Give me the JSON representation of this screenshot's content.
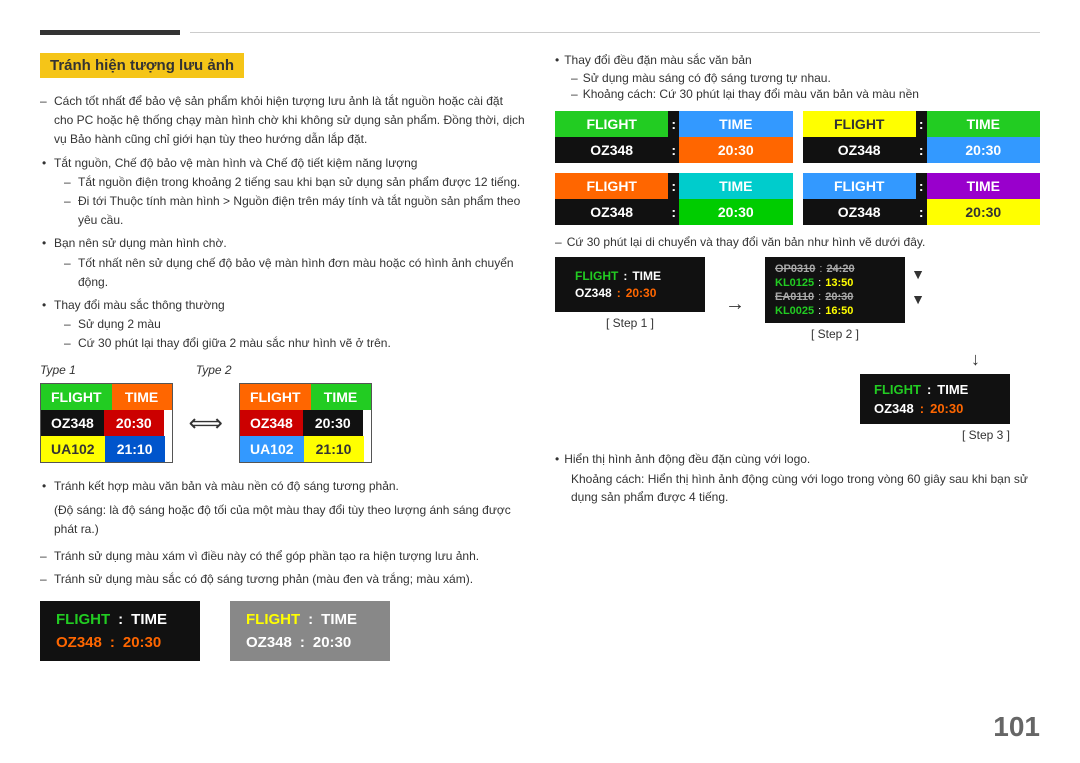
{
  "page": {
    "number": "101"
  },
  "header": {
    "section_title": "Tránh hiện tượng lưu ảnh"
  },
  "left": {
    "intro": "Cách tốt nhất để bảo vệ sản phẩm khỏi hiện tượng lưu ảnh là tắt nguồn hoặc cài đặt cho PC hoặc hệ thống chạy màn hình chờ khi không sử dụng sản phẩm. Đồng thời, dịch vụ Bảo hành cũng chỉ giới hạn tùy theo hướng dẫn lắp đặt.",
    "bullets": [
      {
        "text": "Tắt nguồn, Chế độ bảo vệ màn hình và Chế độ tiết kiệm năng lượng",
        "subs": [
          "Tắt nguồn điện trong khoảng 2 tiếng sau khi bạn sử dụng sản phẩm được 12 tiếng.",
          "Đi tới Thuộc tính màn hình > Nguồn điện trên máy tính và tắt nguồn sản phẩm theo yêu cầu."
        ]
      },
      {
        "text": "Bạn nên sử dụng màn hình chờ.",
        "subs": [
          "Tốt nhất nên sử dụng chế độ bảo vệ màn hình đơn màu hoặc có hình ảnh chuyển động."
        ]
      },
      {
        "text": "Thay đổi màu sắc thông thường",
        "subs": [
          "Sử dụng 2 màu",
          "Cứ 30 phút lại thay đổi giữa 2 màu sắc như hình vẽ ở trên."
        ]
      }
    ],
    "type1_label": "Type 1",
    "type2_label": "Type 2",
    "board_t1": {
      "row1": [
        "FLIGHT",
        "TIME"
      ],
      "row2": [
        "OZ348",
        "20:30"
      ],
      "row3": [
        "UA102",
        "21:10"
      ]
    },
    "board_t2": {
      "row1": [
        "FLIGHT",
        "TIME"
      ],
      "row2": [
        "OZ348",
        "20:30"
      ],
      "row3": [
        "UA102",
        "21:10"
      ]
    },
    "bullet2_items": [
      "Tránh kết hợp màu văn bản và màu nền có độ sáng tương phản.",
      "(Độ sáng: là độ sáng hoặc độ tối của một màu thay đổi tùy theo lượng ánh sáng được phát ra.)"
    ],
    "dash_items": [
      "Tránh sử dụng màu xám vì điều này có thể góp phần tạo ra hiện tượng lưu ảnh.",
      "Tránh sử dụng màu sắc có độ sáng tương phản (màu đen và trắng; màu xám)."
    ],
    "bottom_board_black": {
      "title": [
        "FLIGHT",
        ":",
        "TIME"
      ],
      "value": [
        "OZ348",
        ":",
        "20:30"
      ]
    },
    "bottom_board_gray": {
      "title": [
        "FLIGHT",
        ":",
        "TIME"
      ],
      "value": [
        "OZ348",
        ":",
        "20:30"
      ]
    }
  },
  "right": {
    "bullet1": "Thay đổi đều đặn màu sắc văn bản",
    "sub1": "Sử dụng màu sáng có độ sáng tương tự nhau.",
    "sub2": "Khoảng cách: Cứ 30 phút lại thay đổi màu văn bản và màu nền",
    "boards_top": [
      {
        "id": "rt1",
        "row1_left": "FLIGHT",
        "row1_colon": ":",
        "row1_right": "TIME",
        "row1_left_color": "green",
        "row1_right_color": "blue",
        "row2_left": "OZ348",
        "row2_colon": ":",
        "row2_right": "20:30",
        "row2_left_color": "black",
        "row2_right_color": "orange"
      },
      {
        "id": "rt2",
        "row1_left": "FLIGHT",
        "row1_colon": ":",
        "row1_right": "TIME",
        "row2_left": "OZ348",
        "row2_colon": ":",
        "row2_right": "20:30"
      },
      {
        "id": "rt3",
        "row1_left": "FLIGHT",
        "row1_colon": ":",
        "row1_right": "TIME",
        "row2_left": "OZ348",
        "row2_colon": ":",
        "row2_right": "20:30"
      },
      {
        "id": "rt4",
        "row1_left": "FLIGHT",
        "row1_colon": ":",
        "row1_right": "TIME",
        "row2_left": "OZ348",
        "row2_colon": ":",
        "row2_right": "20:30"
      }
    ],
    "dash_step": "Cứ 30 phút lại di chuyển và thay đổi văn bản như hình vẽ dưới đây.",
    "step1_label": "[ Step 1 ]",
    "step2_label": "[ Step 2 ]",
    "step3_label": "[ Step 3 ]",
    "step1_board": {
      "rows": [
        {
          "col1": "FLIGHT",
          "col2": ":",
          "col3": "TIME"
        },
        {
          "col1": "OZ348",
          "col2": ":",
          "col3": "20:30"
        }
      ]
    },
    "step2_board": {
      "rows": [
        {
          "col1": "OP0310",
          "col2": ":",
          "col3": "24:20"
        },
        {
          "col1": "KL0125",
          "col2": ":",
          "col3": "13:50"
        },
        {
          "col1": "EA0110",
          "col2": ":",
          "col3": "20:30"
        },
        {
          "col1": "KL0025",
          "col2": ":",
          "col3": "16:50"
        }
      ]
    },
    "step3_board": {
      "row1": [
        "FLIGHT",
        ":",
        "TIME"
      ],
      "row2": [
        "OZ348",
        ":",
        "20:30"
      ]
    },
    "final_bullets": [
      "Hiển thị hình ảnh động đều đặn cùng với logo.",
      "Khoảng cách: Hiển thị hình ảnh động cùng với logo trong vòng 60 giây sau khi bạn sử dụng sản phẩm được 4 tiếng."
    ]
  }
}
